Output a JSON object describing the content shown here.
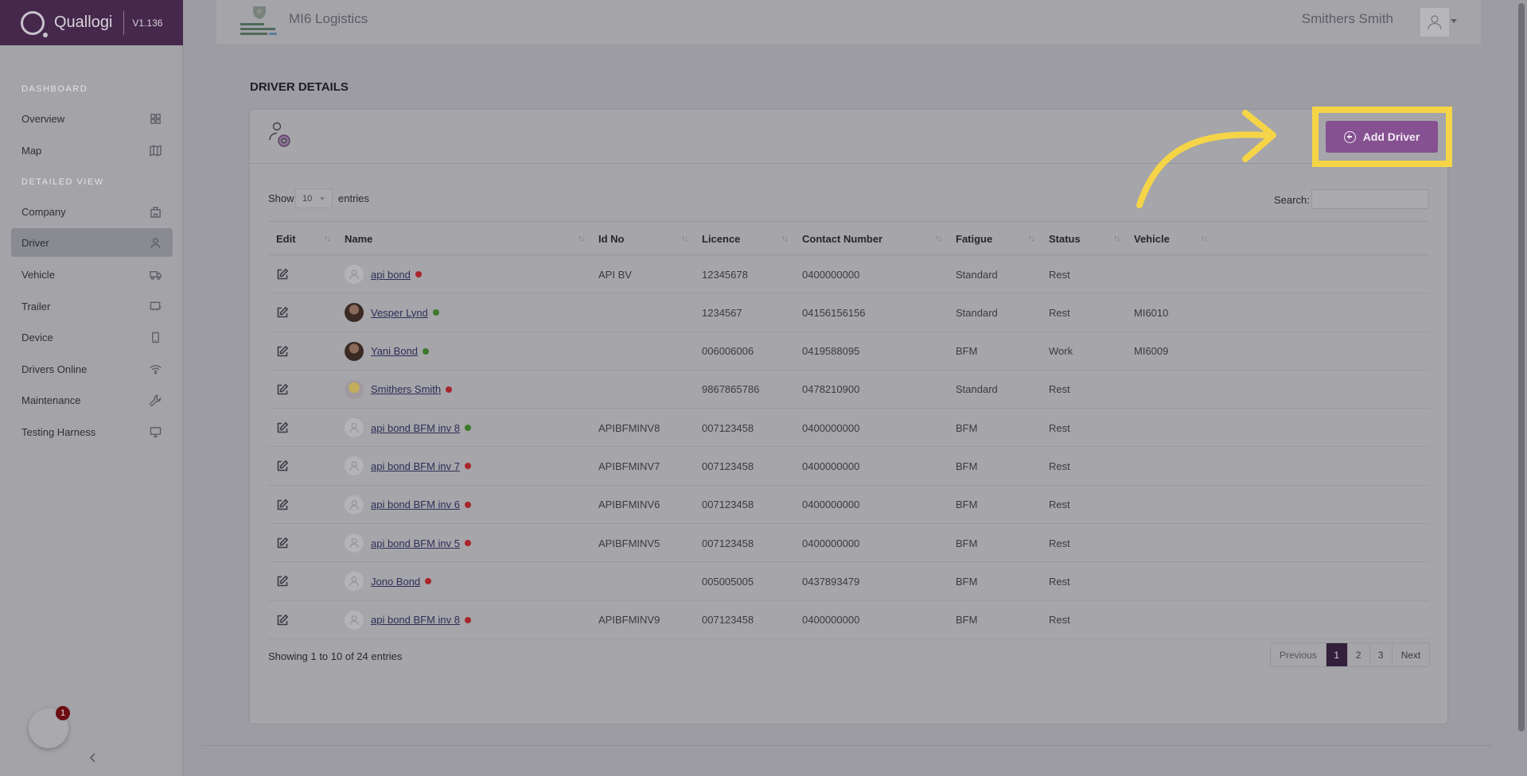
{
  "brand": {
    "name": "Quallogi",
    "version": "V1.136"
  },
  "sidebar": {
    "sections": [
      {
        "label": "DASHBOARD"
      },
      {
        "label": "DETAILED VIEW"
      }
    ],
    "items": [
      {
        "label": "Overview",
        "icon": "grid-icon"
      },
      {
        "label": "Map",
        "icon": "map-icon"
      },
      {
        "label": "Company",
        "icon": "building-icon"
      },
      {
        "label": "Driver",
        "icon": "user-icon",
        "active": true
      },
      {
        "label": "Vehicle",
        "icon": "truck-icon"
      },
      {
        "label": "Trailer",
        "icon": "trailer-icon"
      },
      {
        "label": "Device",
        "icon": "phone-icon"
      },
      {
        "label": "Drivers Online",
        "icon": "wifi-icon"
      },
      {
        "label": "Maintenance",
        "icon": "wrench-icon"
      },
      {
        "label": "Testing Harness",
        "icon": "monitor-icon"
      }
    ],
    "help_badge": "1"
  },
  "topbar": {
    "company": "MI6 Logistics",
    "user": "Smithers Smith"
  },
  "page": {
    "title": "DRIVER DETAILS"
  },
  "actions": {
    "add_driver": "Add Driver"
  },
  "table_controls": {
    "show": "Show",
    "entries_value": "10",
    "entries": "entries",
    "search": "Search:"
  },
  "table": {
    "headers": [
      "Edit",
      "Name",
      "Id No",
      "Licence",
      "Contact Number",
      "Fatigue",
      "Status",
      "Vehicle"
    ],
    "rows": [
      {
        "name": "api bond",
        "online": false,
        "avatar": "placeholder",
        "id_no": "API BV",
        "licence": "12345678",
        "contact": "0400000000",
        "fatigue": "Standard",
        "status": "Rest",
        "vehicle": ""
      },
      {
        "name": "Vesper Lynd",
        "online": true,
        "avatar": "photo",
        "id_no": "",
        "licence": "1234567",
        "contact": "04156156156",
        "fatigue": "Standard",
        "status": "Rest",
        "vehicle": "MI6010"
      },
      {
        "name": "Yani Bond",
        "online": true,
        "avatar": "photo",
        "id_no": "",
        "licence": "006006006",
        "contact": "0419588095",
        "fatigue": "BFM",
        "status": "Work",
        "vehicle": "MI6009"
      },
      {
        "name": "Smithers Smith",
        "online": false,
        "avatar": "minion",
        "id_no": "",
        "licence": "9867865786",
        "contact": "0478210900",
        "fatigue": "Standard",
        "status": "Rest",
        "vehicle": ""
      },
      {
        "name": "api bond BFM inv 8",
        "online": true,
        "avatar": "placeholder",
        "id_no": "APIBFMINV8",
        "licence": "007123458",
        "contact": "0400000000",
        "fatigue": "BFM",
        "status": "Rest",
        "vehicle": ""
      },
      {
        "name": "api bond BFM inv 7",
        "online": false,
        "avatar": "placeholder",
        "id_no": "APIBFMINV7",
        "licence": "007123458",
        "contact": "0400000000",
        "fatigue": "BFM",
        "status": "Rest",
        "vehicle": ""
      },
      {
        "name": "api bond BFM inv 6",
        "online": false,
        "avatar": "placeholder",
        "id_no": "APIBFMINV6",
        "licence": "007123458",
        "contact": "0400000000",
        "fatigue": "BFM",
        "status": "Rest",
        "vehicle": ""
      },
      {
        "name": "api bond BFM inv 5",
        "online": false,
        "avatar": "placeholder",
        "id_no": "APIBFMINV5",
        "licence": "007123458",
        "contact": "0400000000",
        "fatigue": "BFM",
        "status": "Rest",
        "vehicle": ""
      },
      {
        "name": "Jono Bond",
        "online": false,
        "avatar": "placeholder",
        "id_no": "",
        "licence": "005005005",
        "contact": "0437893479",
        "fatigue": "BFM",
        "status": "Rest",
        "vehicle": ""
      },
      {
        "name": "api bond BFM inv 8",
        "online": false,
        "avatar": "placeholder",
        "id_no": "APIBFMINV9",
        "licence": "007123458",
        "contact": "0400000000",
        "fatigue": "BFM",
        "status": "Rest",
        "vehicle": ""
      }
    ]
  },
  "footer": {
    "showing": "Showing 1 to 10 of 24 entries"
  },
  "pagination": {
    "previous": "Previous",
    "pages": [
      "1",
      "2",
      "3"
    ],
    "next": "Next",
    "active": "1"
  },
  "colors": {
    "brand": "#46284d",
    "button": "#855191",
    "highlight": "#f5d547",
    "online": "#3d7a2a",
    "offline": "#a8262c"
  }
}
